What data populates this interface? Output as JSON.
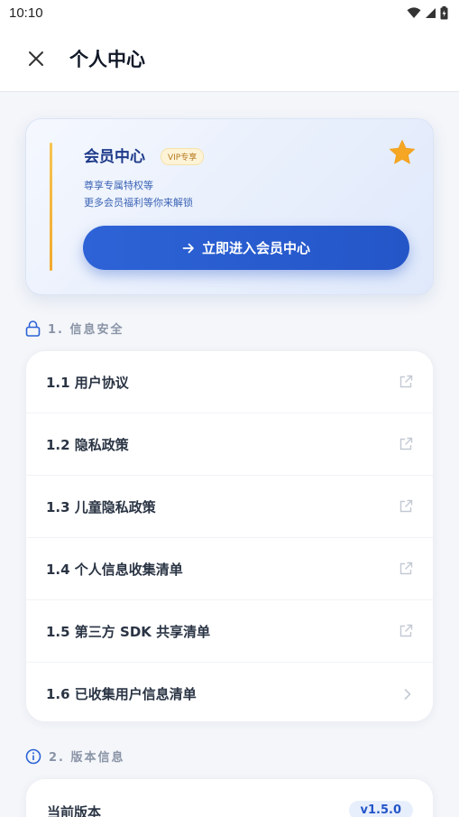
{
  "status_bar": {
    "time": "10:10"
  },
  "header": {
    "title": "个人中心"
  },
  "member_card": {
    "title": "会员中心",
    "badge": "VIP专享",
    "line1": "尊享专属特权等",
    "line2": "更多会员福利等你来解锁",
    "button_label": "立即进入会员中心"
  },
  "section_security": {
    "title": "1. 信息安全",
    "items": [
      {
        "label": "1.1 用户协议",
        "icon": "external-link-icon"
      },
      {
        "label": "1.2 隐私政策",
        "icon": "external-link-icon"
      },
      {
        "label": "1.3 儿童隐私政策",
        "icon": "external-link-icon"
      },
      {
        "label": "1.4 个人信息收集清单",
        "icon": "external-link-icon"
      },
      {
        "label": "1.5 第三方 SDK 共享清单",
        "icon": "external-link-icon"
      },
      {
        "label": "1.6 已收集用户信息清单",
        "icon": "chevron-right-icon"
      }
    ]
  },
  "section_version": {
    "title": "2. 版本信息",
    "current_label": "当前版本",
    "version": "v1.5.0"
  },
  "colors": {
    "accent": "#2456c8",
    "gold": "#f3a82c",
    "background": "#f4f6fa"
  }
}
